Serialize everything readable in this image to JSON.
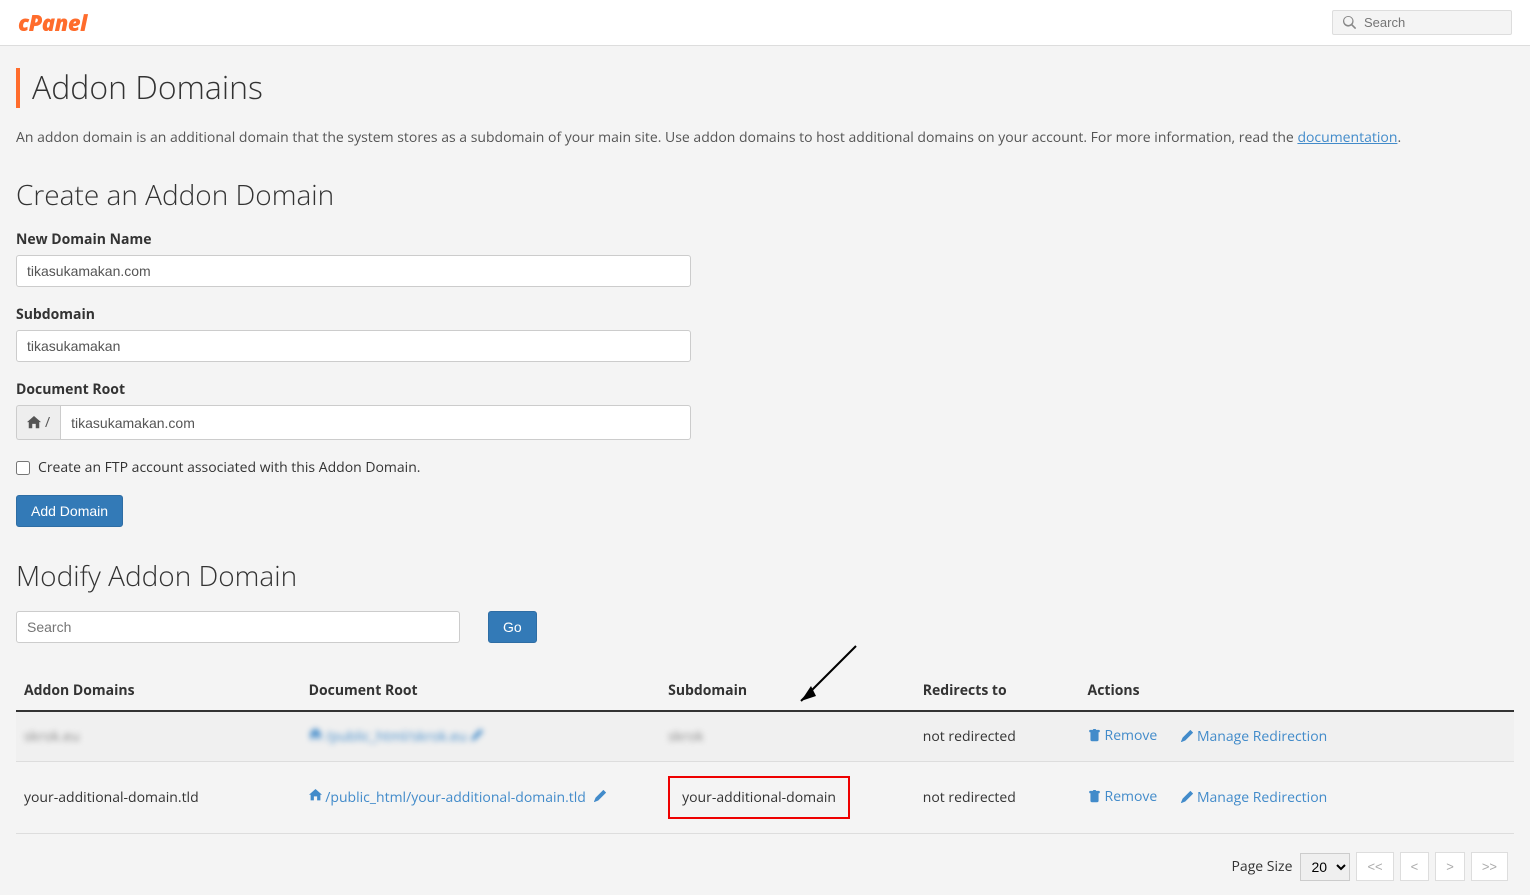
{
  "header": {
    "logo": "cPanel",
    "search_placeholder": "Search"
  },
  "page": {
    "title": "Addon Domains",
    "description_pre": "An addon domain is an additional domain that the system stores as a subdomain of your main site. Use addon domains to host additional domains on your account. For more information, read the ",
    "description_link": "documentation",
    "description_post": "."
  },
  "create": {
    "section_title": "Create an Addon Domain",
    "new_domain_label": "New Domain Name",
    "new_domain_value": "tikasukamakan.com",
    "subdomain_label": "Subdomain",
    "subdomain_value": "tikasukamakan",
    "docroot_label": "Document Root",
    "docroot_prefix": "/",
    "docroot_value": "tikasukamakan.com",
    "ftp_checkbox_label": "Create an FTP account associated with this Addon Domain.",
    "add_button": "Add Domain"
  },
  "modify": {
    "section_title": "Modify Addon Domain",
    "search_placeholder": "Search",
    "go_button": "Go",
    "columns": {
      "addon_domains": "Addon Domains",
      "document_root": "Document Root",
      "subdomain": "Subdomain",
      "redirects_to": "Redirects to",
      "actions": "Actions"
    },
    "rows": [
      {
        "domain": "skrok.eu",
        "docroot": "/public_html/skrok.eu",
        "subdomain": "skrok",
        "redirects": "not redirected",
        "remove": "Remove",
        "manage": "Manage Redirection",
        "blurred": true,
        "highlighted": false
      },
      {
        "domain": "your-additional-domain.tld",
        "docroot": "/public_html/your-additional-domain.tld",
        "subdomain": "your-additional-domain",
        "redirects": "not redirected",
        "remove": "Remove",
        "manage": "Manage Redirection",
        "blurred": false,
        "highlighted": true
      }
    ],
    "pagination": {
      "page_size_label": "Page Size",
      "page_size_value": "20",
      "first": "<<",
      "prev": "<",
      "next": ">",
      "last": ">>"
    }
  }
}
